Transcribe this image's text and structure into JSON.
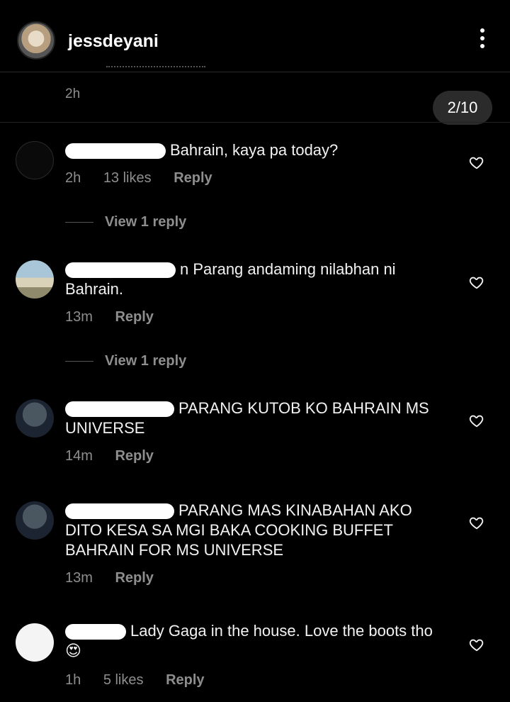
{
  "header": {
    "username": "jessdeyani",
    "more_icon": "more-vertical-icon"
  },
  "previous": {
    "time": "2h"
  },
  "pager": {
    "label": "2/10"
  },
  "comments": [
    {
      "text": "Bahrain, kaya pa today?",
      "time": "2h",
      "likes": "13 likes",
      "reply": "Reply",
      "view_replies": "View 1 reply"
    },
    {
      "text": "n Parang andaming nilabhan ni Bahrain.",
      "time": "13m",
      "likes": "",
      "reply": "Reply",
      "view_replies": "View 1 reply"
    },
    {
      "text": "PARANG KUTOB KO BAHRAIN MS UNIVERSE",
      "time": "14m",
      "likes": "",
      "reply": "Reply"
    },
    {
      "text": "PARANG MAS KINABAHAN AKO DITO KESA SA MGI BAKA COOKING BUFFET BAHRAIN FOR MS UNIVERSE",
      "time": "13m",
      "likes": "",
      "reply": "Reply"
    },
    {
      "text": "Lady Gaga in the house. Love the boots tho😍",
      "time": "1h",
      "likes": "5 likes",
      "reply": "Reply"
    }
  ],
  "icons": {
    "heart": "heart-outline-icon"
  }
}
